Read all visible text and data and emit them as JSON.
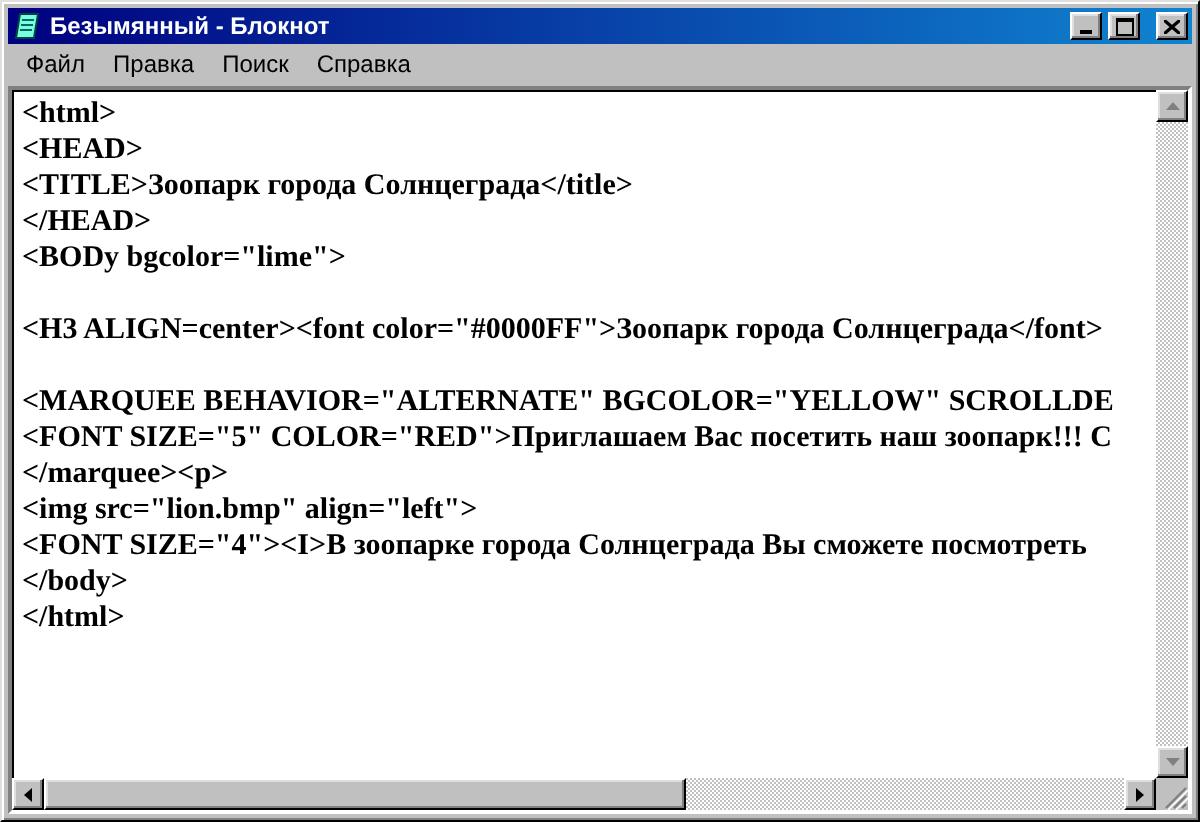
{
  "window": {
    "title": "Безымянный - Блокнот"
  },
  "menu": [
    "Файл",
    "Правка",
    "Поиск",
    "Справка"
  ],
  "lines": [
    {
      "kind": "text",
      "text": "<html>"
    },
    {
      "kind": "text",
      "text": "<HEAD>"
    },
    {
      "kind": "text",
      "text": "<TITLE>Зоопарк города Солнцеграда</title>"
    },
    {
      "kind": "text",
      "text": "</HEAD>"
    },
    {
      "kind": "text",
      "text": "<BODy bgcolor=\"lime\">"
    },
    {
      "kind": "blank"
    },
    {
      "kind": "text",
      "text": "<H3 ALIGN=center><font color=\"#0000FF\">Зоопарк города Солнцеграда</font>"
    },
    {
      "kind": "blank"
    },
    {
      "kind": "text",
      "text": "<MARQUEE BEHAVIOR=\"ALTERNATE\" BGCOLOR=\"YELLOW\" SCROLLDE"
    },
    {
      "kind": "text",
      "text": "<FONT SIZE=\"5\" COLOR=\"RED\">Приглашаем Вас посетить наш зоопарк!!! С"
    },
    {
      "kind": "text",
      "text": "</marquee><p>"
    },
    {
      "kind": "text",
      "text": "<img src=\"lion.bmp\" align=\"left\">"
    },
    {
      "kind": "text",
      "text": "<FONT SIZE=\"4\"><I>В зоопарке города Солнцеграда Вы сможете посмотреть"
    },
    {
      "kind": "text",
      "text": "</body>"
    },
    {
      "kind": "text",
      "text": "</html>"
    }
  ]
}
